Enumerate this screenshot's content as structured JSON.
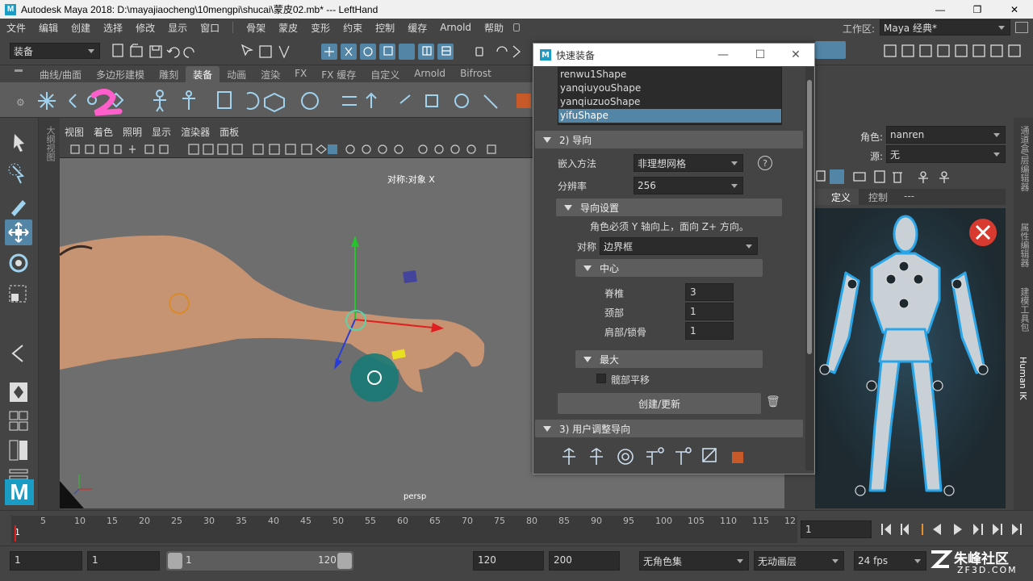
{
  "window": {
    "title": "Autodesk Maya 2018: D:\\mayajiaocheng\\10mengpi\\shucai\\蒙皮02.mb*    ---    LeftHand",
    "logo": "M"
  },
  "menubar": {
    "items": [
      "文件",
      "编辑",
      "创建",
      "选择",
      "修改",
      "显示",
      "窗口",
      "骨架",
      "蒙皮",
      "变形",
      "约束",
      "控制",
      "缓存",
      "Arnold",
      "帮助"
    ],
    "workspace_label": "工作区:",
    "workspace_value": "Maya 经典*"
  },
  "toolrow": {
    "mode_dropdown": "装备"
  },
  "shelf": {
    "tabs": [
      "曲线/曲面",
      "多边形建模",
      "雕刻",
      "装备",
      "动画",
      "渲染",
      "FX",
      "FX 缓存",
      "自定义",
      "Arnold",
      "Bifrost"
    ],
    "active_tab": "装备"
  },
  "annotation": {
    "label": "2"
  },
  "outliner_strip": {
    "label": "大纲视图"
  },
  "viewport": {
    "menu": [
      "视图",
      "着色",
      "照明",
      "显示",
      "渲染器",
      "面板"
    ],
    "symmetry_label": "对称:对象 X",
    "camera_label": "persp"
  },
  "dialog": {
    "title": "快速装备",
    "logo": "M",
    "mesh_list": [
      "renwu1Shape",
      "yanqiuyouShape",
      "yanqiuzuoShape",
      "yifuShape"
    ],
    "selected_mesh": "yifuShape",
    "section_guides": "2) 导向",
    "embed_method_label": "嵌入方法",
    "embed_method_value": "非理想网格",
    "help_icon": "?",
    "resolution_label": "分辨率",
    "resolution_value": "256",
    "guide_settings_label": "导向设置",
    "guide_note": "角色必须 Y 轴向上，面向 Z+ 方向。",
    "symmetry_label": "对称",
    "symmetry_value": "边界框",
    "center_label": "中心",
    "spine_label": "脊椎",
    "spine_value": "3",
    "neck_label": "颈部",
    "neck_value": "1",
    "shoulder_label": "肩部/锁骨",
    "shoulder_value": "1",
    "max_label": "最大",
    "hip_label": "髋部平移",
    "create_update_label": "创建/更新",
    "section_user": "3) 用户调整导向"
  },
  "right_panel": {
    "character_label": "角色:",
    "character_value": "nanren",
    "source_label": "源:",
    "source_value": "无",
    "tabs": [
      "定义",
      "控制",
      "---"
    ],
    "active_tab": "定义",
    "side_tabs": [
      "通道盒/层编辑器",
      "属性编辑器",
      "建模工具包",
      "Human IK"
    ]
  },
  "timeline": {
    "ticks": [
      "5",
      "10",
      "15",
      "20",
      "25",
      "30",
      "35",
      "40",
      "45",
      "50",
      "55",
      "60",
      "65",
      "70",
      "75",
      "80",
      "85",
      "90",
      "95",
      "100",
      "105",
      "110",
      "115",
      "12"
    ],
    "start_tick": "1",
    "current_frame": "1"
  },
  "range": {
    "start": "1",
    "playback_start": "1",
    "slider_start": "1",
    "slider_end": "120",
    "playback_end": "120",
    "end": "200",
    "charset": "无角色集",
    "anim_layer": "无动画层",
    "fps": "24 fps"
  },
  "watermark": {
    "brand": "朱峰社区",
    "url": "ZF3D.COM"
  },
  "colors": {
    "accent": "#5285a6",
    "maya_blue": "#1b9cc4",
    "viewport_bg": "#6e6e6e",
    "close_red": "#d83a2f"
  }
}
